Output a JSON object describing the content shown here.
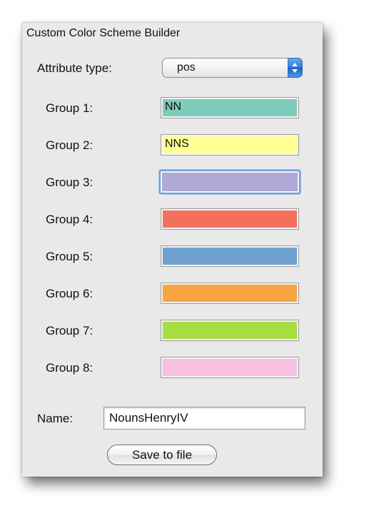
{
  "window": {
    "title": "Custom Color Scheme Builder"
  },
  "attribute": {
    "label": "Attribute type:",
    "selected": "pos"
  },
  "groups": [
    {
      "label": "Group 1:",
      "text": "NN",
      "color": "#7fcbbc"
    },
    {
      "label": "Group 2:",
      "text": "NNS",
      "color": "#ffff96"
    },
    {
      "label": "Group 3:",
      "text": "",
      "color": "#b1a8d8"
    },
    {
      "label": "Group 4:",
      "text": "",
      "color": "#f3705e"
    },
    {
      "label": "Group 5:",
      "text": "",
      "color": "#6fa1cf"
    },
    {
      "label": "Group 6:",
      "text": "",
      "color": "#f8a440"
    },
    {
      "label": "Group 7:",
      "text": "",
      "color": "#a8dd40"
    },
    {
      "label": "Group 8:",
      "text": "",
      "color": "#f6c0e0"
    }
  ],
  "focused_group": 3,
  "name": {
    "label": "Name:",
    "value": "NounsHenryIV"
  },
  "save_button": {
    "label": "Save to file"
  }
}
